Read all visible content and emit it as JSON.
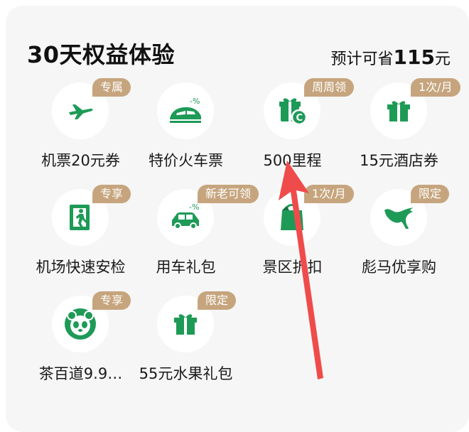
{
  "header": {
    "title": "30天权益体验",
    "save_prefix": "预计可省",
    "save_amount": "115",
    "save_unit": "元"
  },
  "benefits": [
    {
      "label": "机票20元券",
      "badge": "专属",
      "icon": "airplane-icon"
    },
    {
      "label": "特价火车票",
      "badge": "",
      "icon": "train-discount-icon"
    },
    {
      "label": "500里程",
      "badge": "周周领",
      "icon": "gift-coin-icon"
    },
    {
      "label": "15元酒店券",
      "badge": "1次/月",
      "icon": "gift-box-icon"
    },
    {
      "label": "机场快速安检",
      "badge": "专享",
      "icon": "fast-security-icon"
    },
    {
      "label": "用车礼包",
      "badge": "新老可领",
      "icon": "car-discount-icon"
    },
    {
      "label": "景区折扣",
      "badge": "1次/月",
      "icon": "shopping-bag-icon"
    },
    {
      "label": "彪马优享购",
      "badge": "限定",
      "icon": "puma-icon"
    },
    {
      "label": "茶百道9.9…",
      "badge": "专享",
      "icon": "panda-icon"
    },
    {
      "label": "55元水果礼包",
      "badge": "限定",
      "icon": "gift-box-icon"
    }
  ],
  "colors": {
    "icon_green": "#1e9a57",
    "badge": "#c6a57e",
    "arrow": "#f04b4b"
  }
}
